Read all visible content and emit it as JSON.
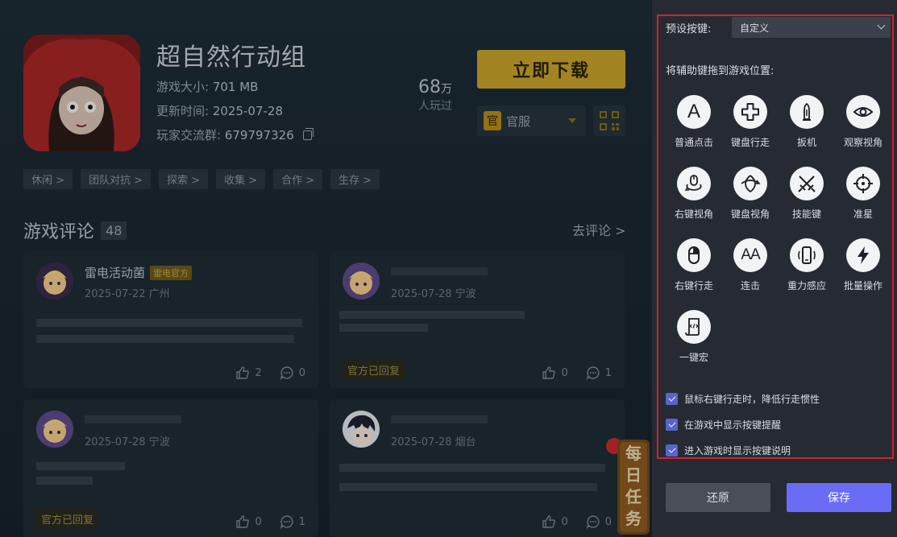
{
  "game": {
    "title": "超自然行动组",
    "size_label": "游戏大小:",
    "size_value": "701 MB",
    "updated_label": "更新时间:",
    "updated_value": "2025-07-28",
    "group_label": "玩家交流群:",
    "group_value": "679797326",
    "players_num": "68",
    "players_unit": "万",
    "players_label": "人玩过",
    "download_label": "立即下载",
    "server_badge": "官",
    "server_label": "官服"
  },
  "tags": [
    "休闲 >",
    "团队对抗 >",
    "探索 >",
    "收集 >",
    "合作 >",
    "生存 >"
  ],
  "reviews": {
    "title": "游戏评论",
    "count": "48",
    "go_review": "去评论 >",
    "cards": [
      {
        "name": "雷电活动菌",
        "badge": "雷电官方",
        "date": "2025-07-22 广州",
        "likes": "2",
        "comments": "0"
      },
      {
        "name": "",
        "date": "2025-07-28 宁波",
        "likes": "0",
        "comments": "1",
        "replied": "官方已回复"
      },
      {
        "name": "",
        "date": "2025-07-28 宁波",
        "likes": "0",
        "comments": "1",
        "replied": "官方已回复"
      },
      {
        "name": "",
        "date": "2025-07-28 烟台",
        "likes": "0",
        "comments": "0"
      }
    ],
    "daily_task": [
      "每",
      "日",
      "任",
      "务"
    ]
  },
  "key_panel": {
    "preset_label": "预设按键:",
    "preset_value": "自定义",
    "drag_hint": "将辅助键拖到游戏位置:",
    "keys": [
      {
        "label": "普通点击",
        "icon": "letter-a-icon"
      },
      {
        "label": "键盘行走",
        "icon": "dpad-icon"
      },
      {
        "label": "扳机",
        "icon": "bullet-icon"
      },
      {
        "label": "观察视角",
        "icon": "eye-icon"
      },
      {
        "label": "右键视角",
        "icon": "mouse-rotate-icon"
      },
      {
        "label": "键盘视角",
        "icon": "keyboard-rotate-icon"
      },
      {
        "label": "技能键",
        "icon": "crossed-swords-icon"
      },
      {
        "label": "准星",
        "icon": "crosshair-icon"
      },
      {
        "label": "右键行走",
        "icon": "mouse-icon"
      },
      {
        "label": "连击",
        "icon": "double-a-icon"
      },
      {
        "label": "重力感应",
        "icon": "phone-tilt-icon"
      },
      {
        "label": "批量操作",
        "icon": "lightning-icon"
      },
      {
        "label": "一键宏",
        "icon": "macro-script-icon"
      }
    ],
    "key_letters": {
      "a": "A",
      "aa": "AA"
    },
    "options": [
      {
        "label": "鼠标右键行走时，降低行走惯性",
        "checked": true
      },
      {
        "label": "在游戏中显示按键提醒",
        "checked": true
      },
      {
        "label": "进入游戏时显示按键说明",
        "checked": true
      }
    ],
    "reset_label": "还原",
    "save_label": "保存",
    "accent_color": "#6a6cf6",
    "highlight_color": "#d1232a"
  }
}
